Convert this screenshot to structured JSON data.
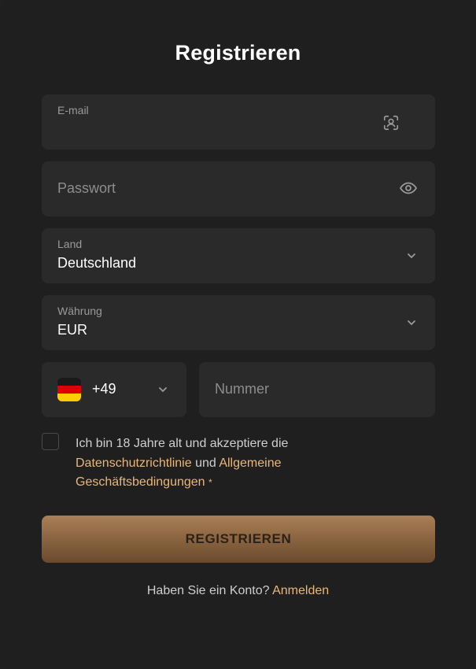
{
  "title": "Registrieren",
  "email": {
    "label": "E-mail",
    "value": "",
    "icon": "face-scan-icon"
  },
  "password": {
    "placeholder": "Passwort",
    "icon": "eye-icon"
  },
  "country": {
    "label": "Land",
    "value": "Deutschland"
  },
  "currency": {
    "label": "Währung",
    "value": "EUR"
  },
  "phone": {
    "code": "+49",
    "flag": "germany-flag",
    "placeholder": "Nummer"
  },
  "terms": {
    "text_before": "Ich bin 18 Jahre alt und akzeptiere die ",
    "privacy_link": "Datenschutzrichtlinie",
    "text_middle": " und ",
    "terms_link": "Allgemeine Geschäftsbedingungen",
    "required_mark": "*"
  },
  "submit_label": "REGISTRIEREN",
  "login": {
    "prompt": "Haben Sie ein Konto? ",
    "link": "Anmelden"
  },
  "colors": {
    "accent": "#e9b77a",
    "button_top": "#a98056",
    "button_bottom": "#6a4a2c"
  }
}
